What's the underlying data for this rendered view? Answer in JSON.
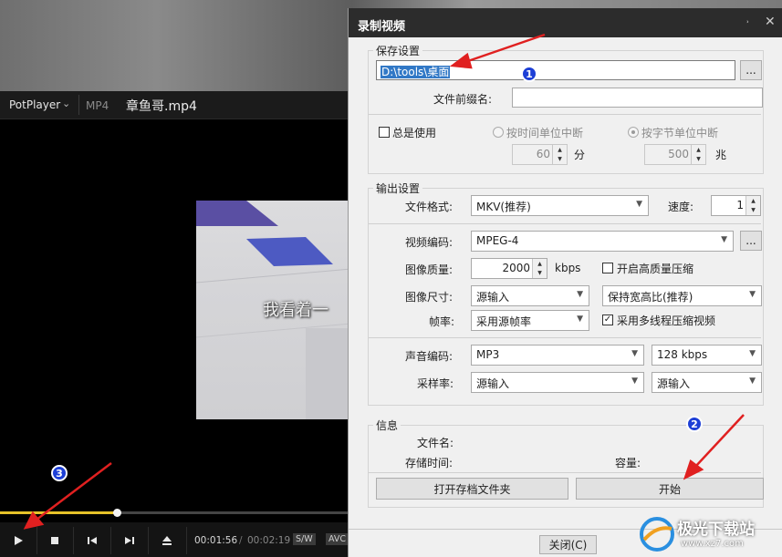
{
  "player": {
    "brand": "PotPlayer",
    "brand_caret": "⌄",
    "format": "MP4",
    "filename": "章鱼哥.mp4",
    "subtitle": "我看着一",
    "progress": 0.335,
    "time_current": "00:01:56",
    "time_separator": "/",
    "time_total": "00:02:19",
    "badge_sw": "S/W",
    "badge_avc": "AVC"
  },
  "dialog": {
    "title": "录制视频",
    "pin_icon": "pin-icon",
    "close_icon": "close-icon",
    "save": {
      "group_title": "保存设置",
      "path": "D:\\tools\\桌面",
      "browse": "...",
      "prefix_label": "文件前缀名:",
      "prefix_value": "",
      "always_use": "总是使用",
      "by_time": "按时间单位中断",
      "by_bytes": "按字节单位中断",
      "time_value": "60",
      "time_unit": "分",
      "bytes_value": "500",
      "bytes_unit": "兆"
    },
    "output": {
      "group_title": "输出设置",
      "format_label": "文件格式:",
      "format_value": "MKV(推荐)",
      "speed_label": "速度:",
      "speed_value": "1",
      "vcodec_label": "视频编码:",
      "vcodec_value": "MPEG-4",
      "vcodec_more": "...",
      "quality_label": "图像质量:",
      "quality_value": "2000",
      "quality_unit": "kbps",
      "hq_label": "开启高质量压缩",
      "size_label": "图像尺寸:",
      "size_value": "源输入",
      "aspect_value": "保持宽高比(推荐)",
      "fps_label": "帧率:",
      "fps_value": "采用源帧率",
      "mt_label": "采用多线程压缩视频",
      "mt_checked": "✓",
      "acodec_label": "声音编码:",
      "acodec_value": "MP3",
      "abitrate_value": "128 kbps",
      "samplerate_label": "采样率:",
      "samplerate_value": "源输入",
      "channels_value": "源输入"
    },
    "info": {
      "group_title": "信息",
      "filename_label": "文件名:",
      "duration_label": "存储时间:",
      "size_label": "容量:",
      "open_folder": "打开存档文件夹",
      "start": "开始"
    },
    "close_button": "关闭(C)"
  },
  "annotations": {
    "step1": "1",
    "step2": "2",
    "step3": "3",
    "arrow_color": "#e02020",
    "badge_color": "#1d3fd6"
  },
  "watermark": {
    "name": "极光下载站",
    "url": "www.xz7.com"
  }
}
